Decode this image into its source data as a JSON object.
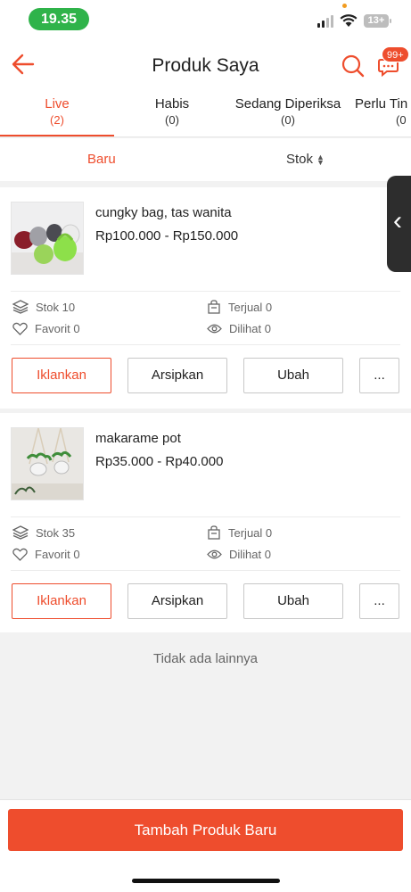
{
  "status_bar": {
    "time": "19.35",
    "battery": "13+"
  },
  "header": {
    "title": "Produk Saya",
    "chat_badge": "99+"
  },
  "tabs": [
    {
      "label": "Live",
      "count": "(2)"
    },
    {
      "label": "Habis",
      "count": "(0)"
    },
    {
      "label": "Sedang Diperiksa",
      "count": "(0)"
    },
    {
      "label": "Perlu Tin",
      "count": "(0"
    }
  ],
  "sort": {
    "new_label": "Baru",
    "stock_label": "Stok"
  },
  "products": [
    {
      "name": "cungky bag, tas wanita",
      "price": "Rp100.000 - Rp150.000",
      "stock": "Stok 10",
      "sold": "Terjual 0",
      "favorite": "Favorit 0",
      "views": "Dilihat 0"
    },
    {
      "name": "makarame pot",
      "price": "Rp35.000 - Rp40.000",
      "stock": "Stok 35",
      "sold": "Terjual 0",
      "favorite": "Favorit 0",
      "views": "Dilihat 0"
    }
  ],
  "actions": {
    "promote": "Iklankan",
    "archive": "Arsipkan",
    "edit": "Ubah",
    "more": "..."
  },
  "no_more": "Tidak ada lainnya",
  "footer": {
    "add_button": "Tambah Produk Baru"
  },
  "colors": {
    "accent": "#ee4d2d",
    "time_pill": "#2fb34a"
  }
}
